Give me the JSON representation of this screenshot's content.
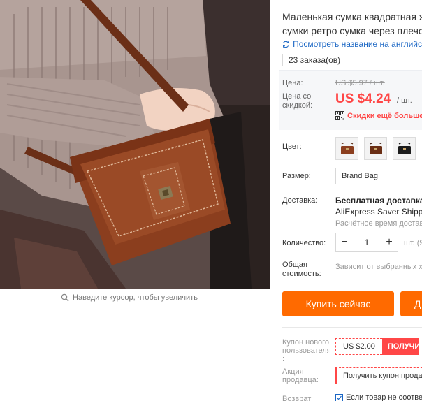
{
  "gallery": {
    "zoom_hint": "Наведите курсор, чтобы увеличить"
  },
  "product": {
    "title_lines": [
      "Маленькая сумка квадратная ж",
      "сумки ретро сумка через плечо"
    ],
    "translate_link": "Посмотреть название на английс",
    "orders": "23 заказа(ов)"
  },
  "price": {
    "label_price": "Цена:",
    "label_discount_1": "Цена со",
    "label_discount_2": "скидкой:",
    "old_price": "US $5.97 / шт.",
    "new_price": "US $4.24",
    "unit": "/ шт.",
    "discount_text": "Скидки ещё больше н"
  },
  "options": {
    "color_label": "Цвет:",
    "color_thumbs": [
      "brown-bag-thumb",
      "dark-brown-bag-thumb",
      "black-bag-thumb"
    ],
    "size_label": "Размер:",
    "size_value": "Brand Bag"
  },
  "shipping": {
    "label": "Доставка:",
    "title": "Бесплатная доставка в",
    "service": "AliExpress Saver Shippin",
    "estimate": "Расчётное время достав"
  },
  "quantity": {
    "label": "Количество:",
    "minus": "−",
    "value": "1",
    "plus": "+",
    "unit": "шт. (9"
  },
  "total": {
    "label_1": "Общая",
    "label_2": "стоимость:",
    "value": "Зависит от выбранных х"
  },
  "actions": {
    "buy_now": "Купить сейчас",
    "add_to_cart": "Д"
  },
  "coupons": {
    "new_user_label_1": "Купон нового",
    "new_user_label_2": "пользователя",
    "new_user_label_3": ":",
    "new_user_amount": "US $2.00",
    "new_user_get": "ПОЛУЧИ",
    "seller_label_1": "Акция",
    "seller_label_2": "продавца:",
    "seller_get": "Получить купон прода",
    "return_label": "Возврат",
    "return_text": "Если товар не соотве"
  },
  "colors": {
    "accent_orange": "#ff6a00",
    "price_red": "#ff4747",
    "link_blue": "#1a66c4"
  }
}
